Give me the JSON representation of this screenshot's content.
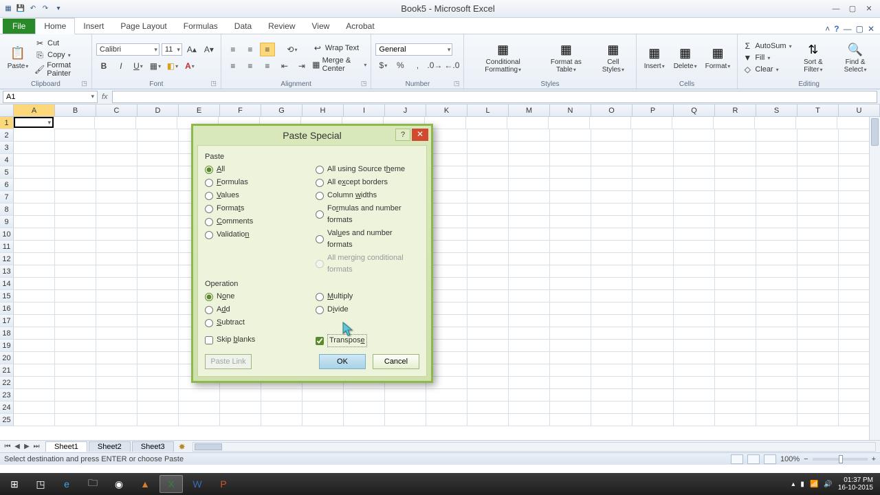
{
  "title": "Book5 - Microsoft Excel",
  "tabs": {
    "file": "File",
    "home": "Home",
    "insert": "Insert",
    "pageLayout": "Page Layout",
    "formulas": "Formulas",
    "data": "Data",
    "review": "Review",
    "view": "View",
    "acrobat": "Acrobat"
  },
  "clipboard": {
    "paste": "Paste",
    "cut": "Cut",
    "copy": "Copy",
    "formatPainter": "Format Painter",
    "label": "Clipboard"
  },
  "font": {
    "name": "Calibri",
    "size": "11",
    "label": "Font"
  },
  "alignment": {
    "wrap": "Wrap Text",
    "merge": "Merge & Center",
    "label": "Alignment"
  },
  "number": {
    "format": "General",
    "label": "Number"
  },
  "styles": {
    "cond": "Conditional Formatting",
    "fmtTable": "Format as Table",
    "cellStyles": "Cell Styles",
    "label": "Styles"
  },
  "cells": {
    "insert": "Insert",
    "delete": "Delete",
    "format": "Format",
    "label": "Cells"
  },
  "editing": {
    "autosum": "AutoSum",
    "fill": "Fill",
    "clear": "Clear",
    "sort": "Sort & Filter",
    "find": "Find & Select",
    "label": "Editing"
  },
  "namebox": "A1",
  "columns": [
    "A",
    "B",
    "C",
    "D",
    "E",
    "F",
    "G",
    "H",
    "I",
    "J",
    "K",
    "L",
    "M",
    "N",
    "O",
    "P",
    "Q",
    "R",
    "S",
    "T",
    "U"
  ],
  "rowCount": 25,
  "sheets": [
    "Sheet1",
    "Sheet2",
    "Sheet3"
  ],
  "statusText": "Select destination and press ENTER or choose Paste",
  "zoom": "100%",
  "dialog": {
    "title": "Paste Special",
    "pasteLabel": "Paste",
    "operationLabel": "Operation",
    "paste": {
      "all": "All",
      "formulas": "Formulas",
      "values": "Values",
      "formats": "Formats",
      "comments": "Comments",
      "validation": "Validation",
      "sourceTheme": "All using Source theme",
      "exceptBorders": "All except borders",
      "colWidths": "Column widths",
      "formulasNum": "Formulas and number formats",
      "valuesNum": "Values and number formats",
      "merging": "All merging conditional formats"
    },
    "op": {
      "none": "None",
      "add": "Add",
      "subtract": "Subtract",
      "multiply": "Multiply",
      "divide": "Divide"
    },
    "skipBlanks": "Skip blanks",
    "transpose": "Transpose",
    "pasteLink": "Paste Link",
    "ok": "OK",
    "cancel": "Cancel"
  },
  "tray": {
    "time": "01:37 PM",
    "date": "16-10-2015"
  }
}
